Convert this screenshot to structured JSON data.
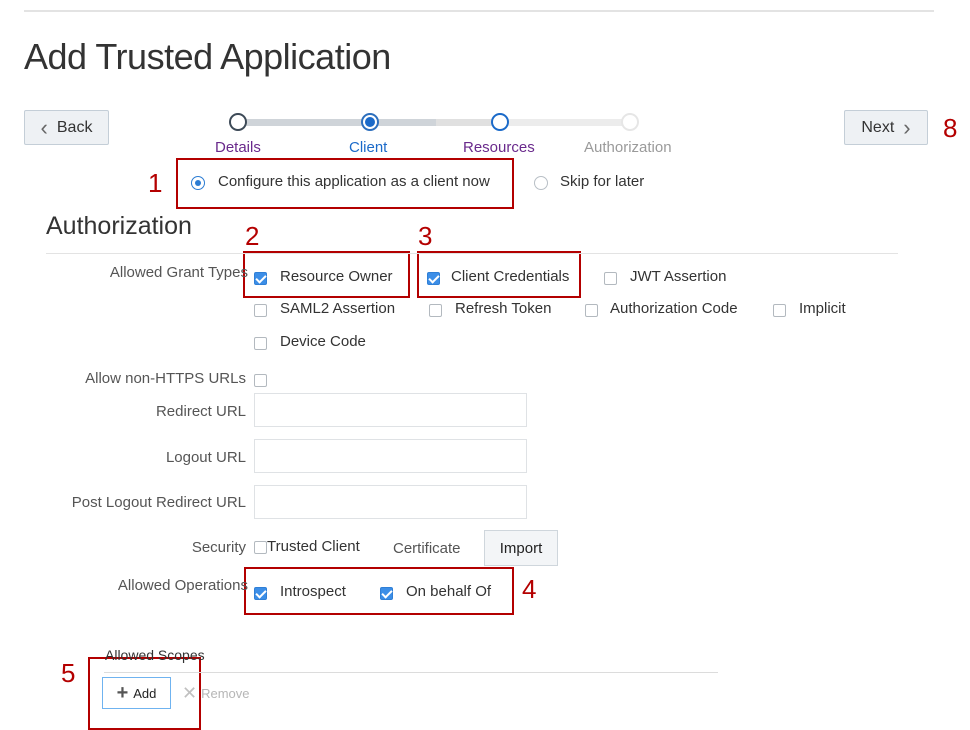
{
  "page_title": "Add Trusted Application",
  "nav": {
    "back_label": "Back",
    "next_label": "Next"
  },
  "train": {
    "steps": [
      {
        "label": "Details",
        "state": "visited",
        "color": "#6a2a8c"
      },
      {
        "label": "Client",
        "state": "current",
        "color": "#1b6ac9"
      },
      {
        "label": "Resources",
        "state": "todo",
        "color": "#6a2a8c"
      },
      {
        "label": "Authorization",
        "state": "disabled",
        "color": "#9a9a9a"
      }
    ]
  },
  "client_config": {
    "option_now": "Configure this application as a client now",
    "option_later": "Skip for later",
    "selected": "now"
  },
  "authorization": {
    "section_title": "Authorization",
    "grant_types_label": "Allowed Grant Types",
    "grant_types": [
      {
        "label": "Resource Owner",
        "checked": true
      },
      {
        "label": "Client Credentials",
        "checked": true
      },
      {
        "label": "JWT Assertion",
        "checked": false
      },
      {
        "label": "SAML2 Assertion",
        "checked": false
      },
      {
        "label": "Refresh Token",
        "checked": false
      },
      {
        "label": "Authorization Code",
        "checked": false
      },
      {
        "label": "Implicit",
        "checked": false
      },
      {
        "label": "Device Code",
        "checked": false
      }
    ],
    "non_https_label": "Allow non-HTTPS URLs",
    "redirect_url_label": "Redirect URL",
    "redirect_url_value": "",
    "logout_url_label": "Logout URL",
    "logout_url_value": "",
    "post_logout_label": "Post Logout Redirect URL",
    "post_logout_value": "",
    "security_label": "Security",
    "trusted_client_label": "Trusted Client",
    "certificate_label": "Certificate",
    "import_label": "Import",
    "allowed_operations_label": "Allowed Operations",
    "operations": [
      {
        "label": "Introspect",
        "checked": true
      },
      {
        "label": "On behalf Of",
        "checked": true
      }
    ],
    "allowed_scopes_label": "Allowed Scopes",
    "add_label": "Add",
    "remove_label": "Remove"
  },
  "annotations": [
    "1",
    "2",
    "3",
    "4",
    "5",
    "8"
  ],
  "colors": {
    "annotation_red": "#b30000",
    "accent_blue": "#1b6ac9",
    "visited_purple": "#6a2a8c"
  }
}
